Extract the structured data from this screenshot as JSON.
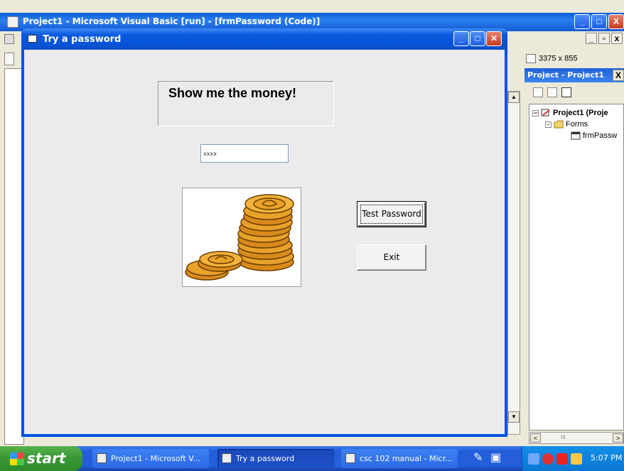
{
  "ide": {
    "title": "Project1 - Microsoft Visual Basic [run] - [frmPassword (Code)]",
    "mdi_buttons": [
      "_",
      "̅",
      "X"
    ],
    "size_readout": "3375 x 855"
  },
  "project_explorer": {
    "title": "Project - Project1",
    "close": "X",
    "tree": [
      {
        "label": "Project1 (Proje",
        "expander": "−"
      },
      {
        "label": "Forms",
        "expander": "−"
      },
      {
        "label": "frmPassw",
        "expander": ""
      }
    ],
    "scroll_left": "<",
    "scroll_mid": "III",
    "scroll_right": ">"
  },
  "form": {
    "title": "Try a password",
    "label_text": "Show me the money!",
    "password_value": "xxxx",
    "test_button_label": "Test Password",
    "exit_button_label": "Exit"
  },
  "taskbar": {
    "start_label": "start",
    "tasks": [
      {
        "label": "Project1 - Microsoft V..."
      },
      {
        "label": "Try a password"
      },
      {
        "label": "csc 102 manual - Micr..."
      }
    ],
    "clock": "5:07 PM"
  },
  "colors": {
    "title_blue": "#0a5ae0",
    "client_bg": "#ebebed",
    "coin_gold": "#e8a22a"
  }
}
